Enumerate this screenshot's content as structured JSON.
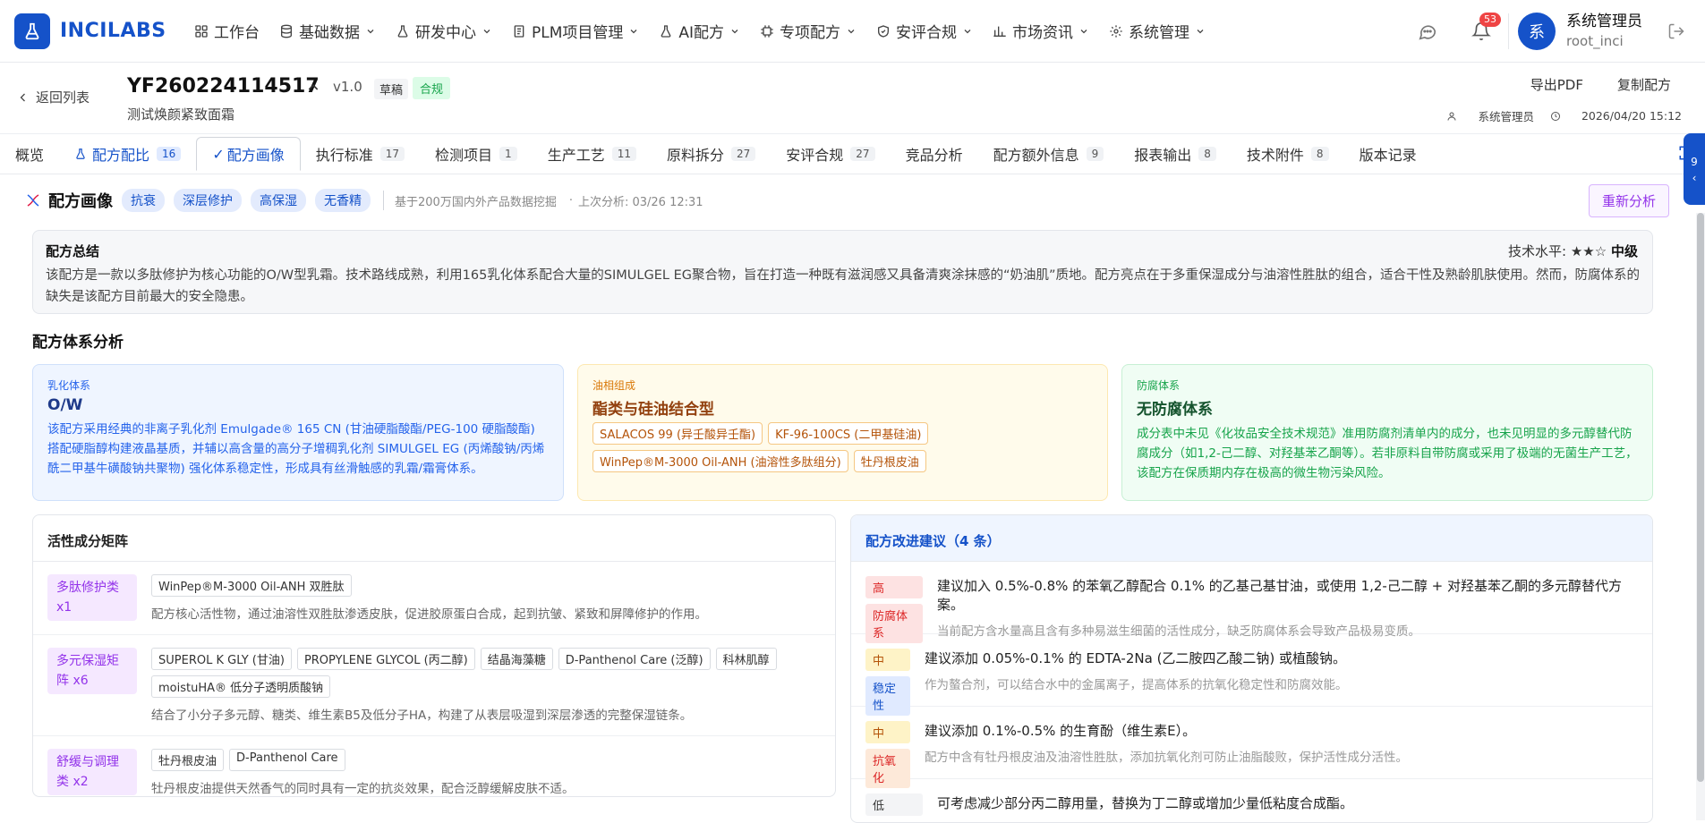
{
  "app": {
    "name": "INCILABS",
    "brand_color": "#1552c9"
  },
  "nav": {
    "items": [
      {
        "label": "工作台",
        "icon": "grid-icon",
        "dropdown": false
      },
      {
        "label": "基础数据",
        "icon": "database-icon",
        "dropdown": true
      },
      {
        "label": "研发中心",
        "icon": "flask-icon",
        "dropdown": true
      },
      {
        "label": "PLM项目管理",
        "icon": "document-icon",
        "dropdown": true
      },
      {
        "label": "AI配方",
        "icon": "flask-icon",
        "dropdown": true
      },
      {
        "label": "专项配方",
        "icon": "chip-icon",
        "dropdown": true
      },
      {
        "label": "安评合规",
        "icon": "shield-icon",
        "dropdown": true
      },
      {
        "label": "市场资讯",
        "icon": "bar-chart-icon",
        "dropdown": true
      },
      {
        "label": "系统管理",
        "icon": "gear-icon",
        "dropdown": true
      }
    ],
    "notification_count": "53",
    "user": {
      "avatar": "系",
      "name": "系统管理员",
      "id": "root_inci"
    }
  },
  "header": {
    "back_label": "返回列表",
    "code": "YF260224114517",
    "version": "v1.0",
    "status_draft": "草稿",
    "status_compliance": "合规",
    "product_name": "测试焕颜紧致面霜",
    "export_pdf": "导出PDF",
    "copy_formula": "复制配方",
    "owner": "系统管理员",
    "datetime": "2026/04/20 15:12"
  },
  "tabs": [
    {
      "label": "概览",
      "count": ""
    },
    {
      "label": "配方配比",
      "count": "16"
    },
    {
      "label": "配方画像",
      "count": ""
    },
    {
      "label": "执行标准",
      "count": "17"
    },
    {
      "label": "检测项目",
      "count": "1"
    },
    {
      "label": "生产工艺",
      "count": "11"
    },
    {
      "label": "原料拆分",
      "count": "27"
    },
    {
      "label": "安评合规",
      "count": "27"
    },
    {
      "label": "竞品分析",
      "count": ""
    },
    {
      "label": "配方额外信息",
      "count": "9"
    },
    {
      "label": "报表输出",
      "count": "8"
    },
    {
      "label": "技术附件",
      "count": "8"
    },
    {
      "label": "版本记录",
      "count": ""
    }
  ],
  "side_handle_count": "9",
  "portrait": {
    "title": "配方画像",
    "tags": [
      "抗衰",
      "深层修护",
      "高保湿",
      "无香精"
    ],
    "source_note": "基于200万国内外产品数据挖掘",
    "last_analysis": "上次分析: 03/26 12:31",
    "reanalyze": "重新分析"
  },
  "summary": {
    "title": "配方总结",
    "level_label": "技术水平:",
    "level_stars": "★★☆",
    "level_value": "中级",
    "text": "该配方是一款以多肽修护为核心功能的O/W型乳霜。技术路线成熟，利用165乳化体系配合大量的SIMULGEL EG聚合物，旨在打造一种既有滋润感又具备清爽涂抹感的“奶油肌”质地。配方亮点在于多重保湿成分与油溶性胜肽的组合，适合干性及熟龄肌肤使用。然而，防腐体系的缺失是该配方目前最大的安全隐患。"
  },
  "system_analysis": {
    "title": "配方体系分析",
    "emulsion": {
      "label": "乳化体系",
      "heading": "O/W",
      "text": "该配方采用经典的非离子乳化剂 Emulgade® 165 CN (甘油硬脂酸酯/PEG-100 硬脂酸酯) 搭配硬脂醇构建液晶基质，并辅以高含量的高分子增稠乳化剂 SIMULGEL EG (丙烯酸钠/丙烯酰二甲基牛磺酸钠共聚物) 强化体系稳定性，形成具有丝滑触感的乳霜/霜膏体系。"
    },
    "oil": {
      "label": "油相组成",
      "heading": "酯类与硅油结合型",
      "tags": [
        "SALACOS 99 (异壬酸异壬酯)",
        "KF-96-100CS (二甲基硅油)",
        "WinPep®M-3000 Oil-ANH (油溶性多肽组分)",
        "牡丹根皮油"
      ]
    },
    "preservative": {
      "label": "防腐体系",
      "heading": "无防腐体系",
      "text": "成分表中未见《化妆品安全技术规范》准用防腐剂清单内的成分，也未见明显的多元醇替代防腐成分（如1,2-己二醇、对羟基苯乙酮等）。若非原料自带防腐或采用了极端的无菌生产工艺，该配方在保质期内存在极高的微生物污染风险。"
    }
  },
  "active_matrix": {
    "title": "活性成分矩阵",
    "rows": [
      {
        "category": "多肽修护类 x1",
        "tags": [
          "WinPep®M-3000 Oil-ANH 双胜肽"
        ],
        "desc": "配方核心活性物，通过油溶性双胜肽渗透皮肤，促进胶原蛋白合成，起到抗皱、紧致和屏障修护的作用。"
      },
      {
        "category": "多元保湿矩阵 x6",
        "tags": [
          "SUPEROL K GLY (甘油)",
          "PROPYLENE GLYCOL (丙二醇)",
          "结晶海藻糖",
          "D-Panthenol Care (泛醇)",
          "科林肌醇",
          "moistuHA® 低分子透明质酸钠"
        ],
        "desc": "结合了小分子多元醇、糖类、维生素B5及低分子HA，构建了从表层吸湿到深层渗透的完整保湿链条。"
      },
      {
        "category": "舒缓与调理类 x2",
        "tags": [
          "牡丹根皮油",
          "D-Panthenol Care"
        ],
        "desc": "牡丹根皮油提供天然香气的同时具有一定的抗炎效果，配合泛醇缓解皮肤不适。"
      }
    ]
  },
  "suggestions": {
    "title": "配方改进建议（4 条）",
    "items": [
      {
        "level": "高",
        "category": "防腐体系",
        "text": "建议加入 0.5%-0.8% 的苯氧乙醇配合 0.1% 的乙基己基甘油，或使用 1,2-己二醇 + 对羟基苯乙酮的多元醇替代方案。",
        "note": "当前配方含水量高且含有多种易滋生细菌的活性成分，缺乏防腐体系会导致产品极易变质。"
      },
      {
        "level": "中",
        "category": "稳定性",
        "text": "建议添加 0.05%-0.1% 的 EDTA-2Na (乙二胺四乙酸二钠) 或植酸钠。",
        "note": "作为螯合剂，可以结合水中的金属离子，提高体系的抗氧化稳定性和防腐效能。"
      },
      {
        "level": "中",
        "category": "抗氧化",
        "text": "建议添加 0.1%-0.5% 的生育酚（维生素E）。",
        "note": "配方中含有牡丹根皮油及油溶性胜肽，添加抗氧化剂可防止油脂酸败，保护活性成分活性。"
      },
      {
        "level": "低",
        "category": "",
        "text": "可考虑减少部分丙二醇用量，替换为丁二醇或增加少量低粘度合成酯。",
        "note": ""
      }
    ]
  }
}
